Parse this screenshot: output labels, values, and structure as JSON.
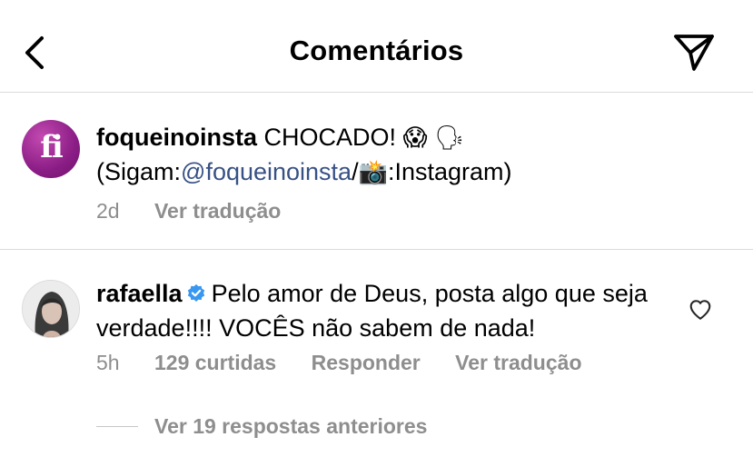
{
  "header": {
    "title": "Comentários",
    "back_icon": "back-arrow-icon",
    "send_icon": "paper-plane-icon"
  },
  "caption": {
    "username": "foqueinoinsta",
    "avatar_text": "fi",
    "text_main": "CHOCADO!",
    "emoji_1": "😱",
    "emoji_2": "🗣",
    "line2_prefix": "(Sigam:",
    "mention": "@foqueinoinsta",
    "slash": "/",
    "emoji_camera": "📸",
    "line2_suffix": ":Instagram)",
    "time": "2d",
    "translate": "Ver tradução"
  },
  "comment": {
    "username": "rafaella",
    "verified_icon": "verified-badge-icon",
    "text": "Pelo amor de Deus, posta algo que seja verdade!!!! VOCÊS não sabem de nada!",
    "time": "5h",
    "likes": "129 curtidas",
    "reply": "Responder",
    "translate": "Ver tradução",
    "view_replies": "Ver 19 respostas anteriores",
    "like_icon": "heart-outline-icon"
  },
  "colors": {
    "link": "#385185",
    "meta_gray": "#8e8e8e",
    "divider": "#dbdbdb",
    "verified_blue": "#3897f0",
    "avatar_purple": "#8b1d86"
  }
}
